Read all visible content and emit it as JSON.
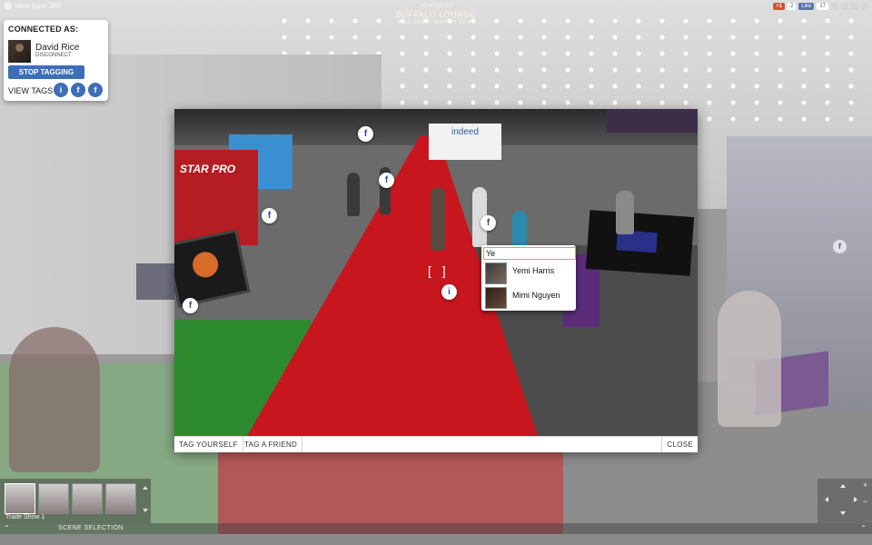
{
  "app": {
    "logo_text": "New Spin 360"
  },
  "promo": {
    "line1": "JOIN US AT",
    "venue": "BUFFALO LOUNGE",
    "line3": "2012 SXSW, MARCH 12-14"
  },
  "share": {
    "gplus_label": "+1",
    "gplus_count": "2",
    "fb_like_label": "Like",
    "fb_like_count": "17"
  },
  "connected": {
    "heading": "CONNECTED AS:",
    "user_name": "David Rice",
    "disconnect_label": "DISCONNECT",
    "stop_button": "STOP TAGGING",
    "view_tags_label": "VIEW TAGS"
  },
  "tagging": {
    "search_value": "Ye",
    "suggestions": [
      {
        "name": "Yemi Harris"
      },
      {
        "name": "Mimi Nguyen"
      }
    ],
    "crosshair": "[ ]",
    "booth_starpro": "STAR PRO",
    "booth_indeed": "indeed",
    "footer": {
      "tag_yourself": "TAG YOURSELF",
      "tag_friend": "TAG A FRIEND",
      "close": "CLOSE"
    }
  },
  "thumbnails": {
    "caption": "Trade Show 1"
  },
  "scene_bar": {
    "label": "SCENE SELECTION"
  },
  "nav": {
    "zoom_in": "+",
    "zoom_out": "−"
  },
  "colors": {
    "accent": "#3d6eb8",
    "facebook": "#3b5998",
    "carpet": "#c8161e"
  },
  "icons": {
    "facebook": "facebook-f-icon",
    "tag": "tag-icon",
    "pin": "facebook-tag-pin-icon"
  }
}
